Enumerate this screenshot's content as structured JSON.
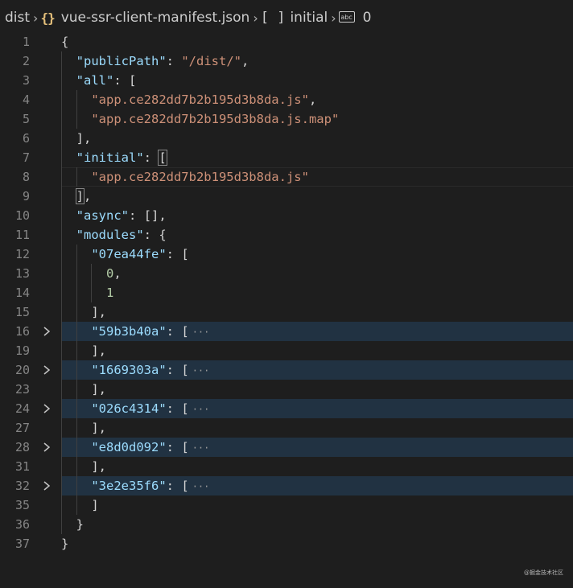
{
  "breadcrumb": {
    "folder": "dist",
    "file_icon": "json-curly-braces-icon",
    "file": "vue-ssr-client-manifest.json",
    "array_icon": "array-brackets-icon",
    "key": "initial",
    "string_icon": "string-abc-icon",
    "string_icon_text": "abc",
    "index": "0"
  },
  "editor": {
    "lines": [
      {
        "num": "1",
        "text": "{"
      },
      {
        "num": "2",
        "text": "  \"publicPath\": \"/dist/\","
      },
      {
        "num": "3",
        "text": "  \"all\": ["
      },
      {
        "num": "4",
        "text": "    \"app.ce282dd7b2b195d3b8da.js\","
      },
      {
        "num": "5",
        "text": "    \"app.ce282dd7b2b195d3b8da.js.map\""
      },
      {
        "num": "6",
        "text": "  ],"
      },
      {
        "num": "7",
        "text": "  \"initial\": ["
      },
      {
        "num": "8",
        "text": "    \"app.ce282dd7b2b195d3b8da.js\""
      },
      {
        "num": "9",
        "text": "  ],"
      },
      {
        "num": "10",
        "text": "  \"async\": [],"
      },
      {
        "num": "11",
        "text": "  \"modules\": {"
      },
      {
        "num": "12",
        "text": "    \"07ea44fe\": ["
      },
      {
        "num": "13",
        "text": "      0,"
      },
      {
        "num": "14",
        "text": "      1"
      },
      {
        "num": "15",
        "text": "    ],"
      },
      {
        "num": "16",
        "text": "    \"59b3b40a\": [",
        "folded": true
      },
      {
        "num": "19",
        "text": "    ],"
      },
      {
        "num": "20",
        "text": "    \"1669303a\": [",
        "folded": true
      },
      {
        "num": "23",
        "text": "    ],"
      },
      {
        "num": "24",
        "text": "    \"026c4314\": [",
        "folded": true
      },
      {
        "num": "27",
        "text": "    ],"
      },
      {
        "num": "28",
        "text": "    \"e8d0d092\": [",
        "folded": true
      },
      {
        "num": "31",
        "text": "    ],"
      },
      {
        "num": "32",
        "text": "    \"3e2e35f6\": [",
        "folded": true
      },
      {
        "num": "35",
        "text": "    ]"
      },
      {
        "num": "36",
        "text": "  }"
      },
      {
        "num": "37",
        "text": "}"
      }
    ],
    "fold_ellipsis": "···"
  },
  "watermark": "@掘金技术社区",
  "colors": {
    "background": "#1e1e1e",
    "key": "#9cdcfe",
    "string": "#ce9178",
    "number": "#b5cea8",
    "punctuation": "#d4d4d4",
    "line_number": "#858585",
    "folded_highlight": "#213242",
    "json_icon": "#e5c07b"
  }
}
